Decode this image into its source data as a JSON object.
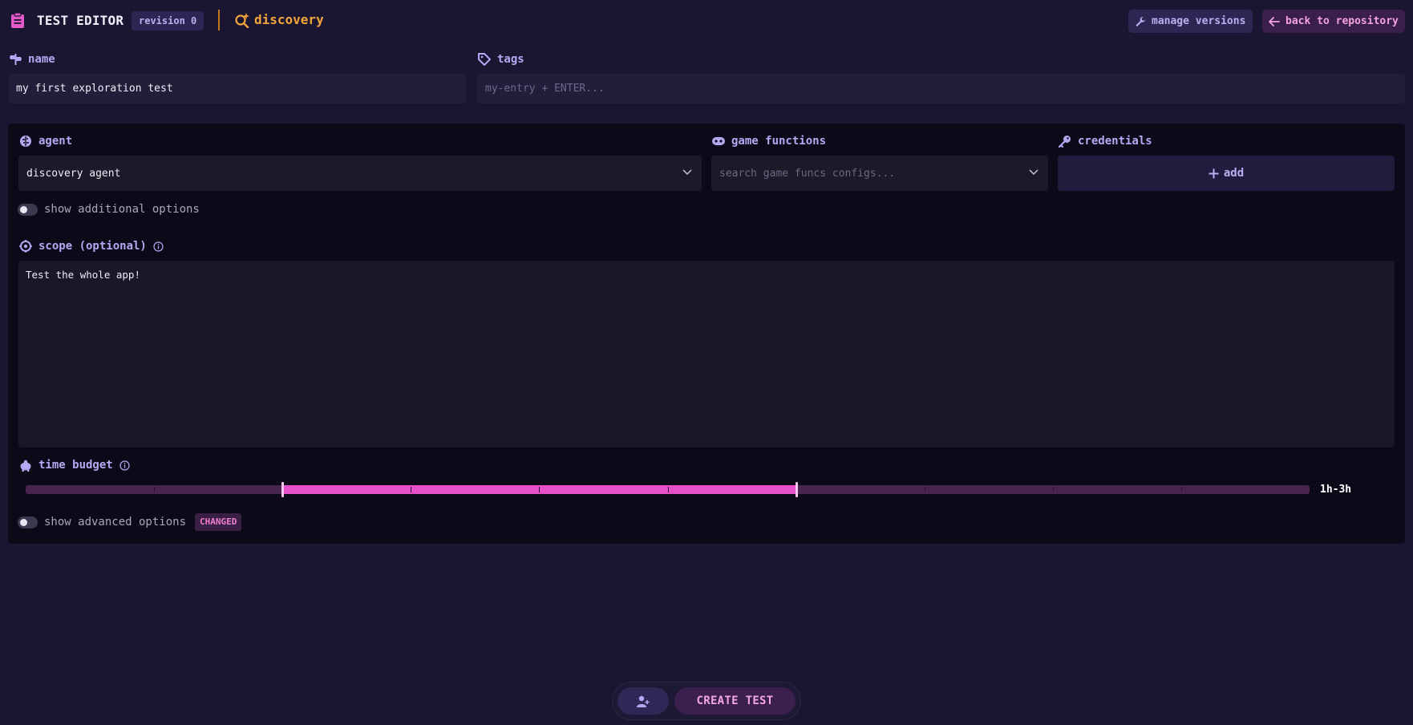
{
  "header": {
    "title": "TEST EDITOR",
    "revision": "revision 0",
    "mode": "discovery",
    "manage_versions": "manage versions",
    "back_to_repository": "back to repository"
  },
  "name": {
    "label": "name",
    "value": "my first exploration test"
  },
  "tags": {
    "label": "tags",
    "placeholder": "my-entry + ENTER..."
  },
  "agent": {
    "label": "agent",
    "value": "discovery agent"
  },
  "game_functions": {
    "label": "game functions",
    "placeholder": "search game funcs configs..."
  },
  "credentials": {
    "label": "credentials",
    "add_label": "add"
  },
  "additional_options": {
    "label": "show additional options",
    "enabled": false
  },
  "scope": {
    "label": "scope (optional)",
    "value": "Test the whole app!"
  },
  "time_budget": {
    "label": "time budget",
    "value": "1h-3h",
    "range_start_fraction": 0.2,
    "range_end_fraction": 0.6,
    "tick_count": 10
  },
  "advanced_options": {
    "label": "show advanced options",
    "enabled": false,
    "badge": "CHANGED"
  },
  "actions": {
    "create_label": "CREATE TEST",
    "user_icon": "user-plus-icon"
  },
  "colors": {
    "background": "#1a1530",
    "panel": "#0c0a18",
    "accent_purple": "#b3a9f3",
    "accent_pink": "#e84fca",
    "accent_orange": "#f2a53a"
  }
}
